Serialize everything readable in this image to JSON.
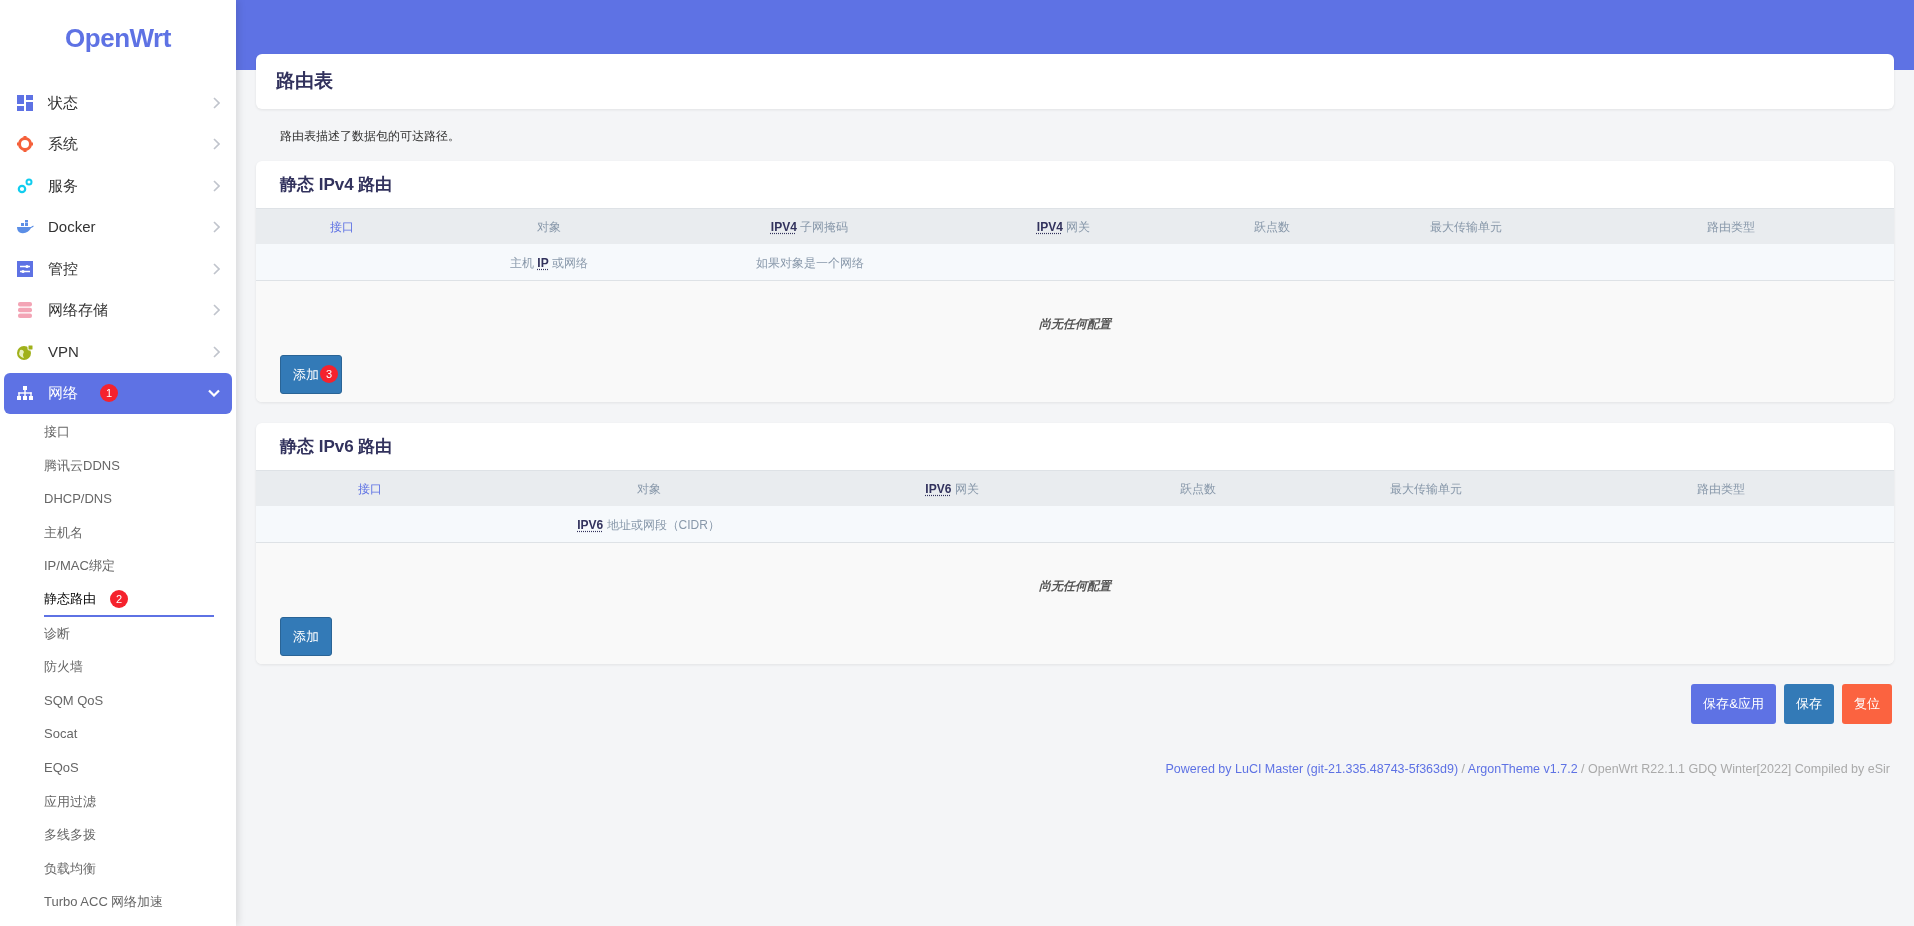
{
  "brand": "OpenWrt",
  "sidebar": {
    "items": [
      {
        "label": "状态",
        "selected": false,
        "expanded": false
      },
      {
        "label": "系统",
        "selected": false,
        "expanded": false
      },
      {
        "label": "服务",
        "selected": false,
        "expanded": false
      },
      {
        "label": "Docker",
        "selected": false,
        "expanded": false
      },
      {
        "label": "管控",
        "selected": false,
        "expanded": false
      },
      {
        "label": "网络存储",
        "selected": false,
        "expanded": false
      },
      {
        "label": "VPN",
        "selected": false,
        "expanded": false
      },
      {
        "label": "网络",
        "selected": true,
        "expanded": true,
        "badge": "1",
        "children": [
          {
            "label": "接口",
            "selected": false
          },
          {
            "label": "腾讯云DDNS",
            "selected": false
          },
          {
            "label": "DHCP/DNS",
            "selected": false
          },
          {
            "label": "主机名",
            "selected": false
          },
          {
            "label": "IP/MAC绑定",
            "selected": false
          },
          {
            "label": "静态路由",
            "selected": true,
            "badge": "2"
          },
          {
            "label": "诊断",
            "selected": false
          },
          {
            "label": "防火墙",
            "selected": false
          },
          {
            "label": "SQM QoS",
            "selected": false
          },
          {
            "label": "Socat",
            "selected": false
          },
          {
            "label": "EQoS",
            "selected": false
          },
          {
            "label": "应用过滤",
            "selected": false
          },
          {
            "label": "多线多拨",
            "selected": false
          },
          {
            "label": "负载均衡",
            "selected": false
          },
          {
            "label": "Turbo ACC 网络加速",
            "selected": false
          }
        ]
      }
    ]
  },
  "page": {
    "title": "路由表",
    "description": "路由表描述了数据包的可达路径。"
  },
  "sections": [
    {
      "title": "静态 IPv4 路由",
      "columns": [
        {
          "label": [
            {
              "text": "接口",
              "kind": "link"
            }
          ]
        },
        {
          "label": [
            {
              "text": "对象"
            }
          ],
          "description": [
            {
              "text": "主机 "
            },
            {
              "text": "IP",
              "kind": "abbr"
            },
            {
              "text": " 或网络"
            }
          ]
        },
        {
          "label": [
            {
              "text": "IPV4",
              "kind": "abbr"
            },
            {
              "text": " 子网掩码"
            }
          ],
          "description": [
            {
              "text": "如果对象是一个网络"
            }
          ]
        },
        {
          "label": [
            {
              "text": "IPV4",
              "kind": "abbr"
            },
            {
              "text": " 网关"
            }
          ]
        },
        {
          "label": [
            {
              "text": "跃点数"
            }
          ]
        },
        {
          "label": [
            {
              "text": "最大传输单元"
            }
          ]
        },
        {
          "label": [
            {
              "text": "路由类型"
            }
          ]
        }
      ],
      "empty_text": "尚无任何配置",
      "add_button": {
        "label": "添加",
        "badge": "3"
      }
    },
    {
      "title": "静态 IPv6 路由",
      "columns": [
        {
          "label": [
            {
              "text": "接口",
              "kind": "link"
            }
          ]
        },
        {
          "label": [
            {
              "text": "对象"
            }
          ],
          "description": [
            {
              "text": "IPV6",
              "kind": "abbr"
            },
            {
              "text": " 地址或网段（CIDR）"
            }
          ]
        },
        {
          "label": [
            {
              "text": "IPV6",
              "kind": "abbr"
            },
            {
              "text": " 网关"
            }
          ]
        },
        {
          "label": [
            {
              "text": "跃点数"
            }
          ]
        },
        {
          "label": [
            {
              "text": "最大传输单元"
            }
          ]
        },
        {
          "label": [
            {
              "text": "路由类型"
            }
          ]
        }
      ],
      "empty_text": "尚无任何配置",
      "add_button": {
        "label": "添加"
      }
    }
  ],
  "actions": [
    {
      "label": "保存&应用",
      "kind": "apply"
    },
    {
      "label": "保存",
      "kind": "save"
    },
    {
      "label": "复位",
      "kind": "reset"
    }
  ],
  "footer": [
    {
      "text": "Powered by LuCI Master (git-21.335.48743-5f363d9)",
      "link": true
    },
    {
      "text": " / ",
      "link": false
    },
    {
      "text": "ArgonTheme v1.7.2",
      "link": true
    },
    {
      "text": " / OpenWrt R22.1.1 GDQ Winter[2022] Compiled by eSir",
      "link": false
    }
  ]
}
